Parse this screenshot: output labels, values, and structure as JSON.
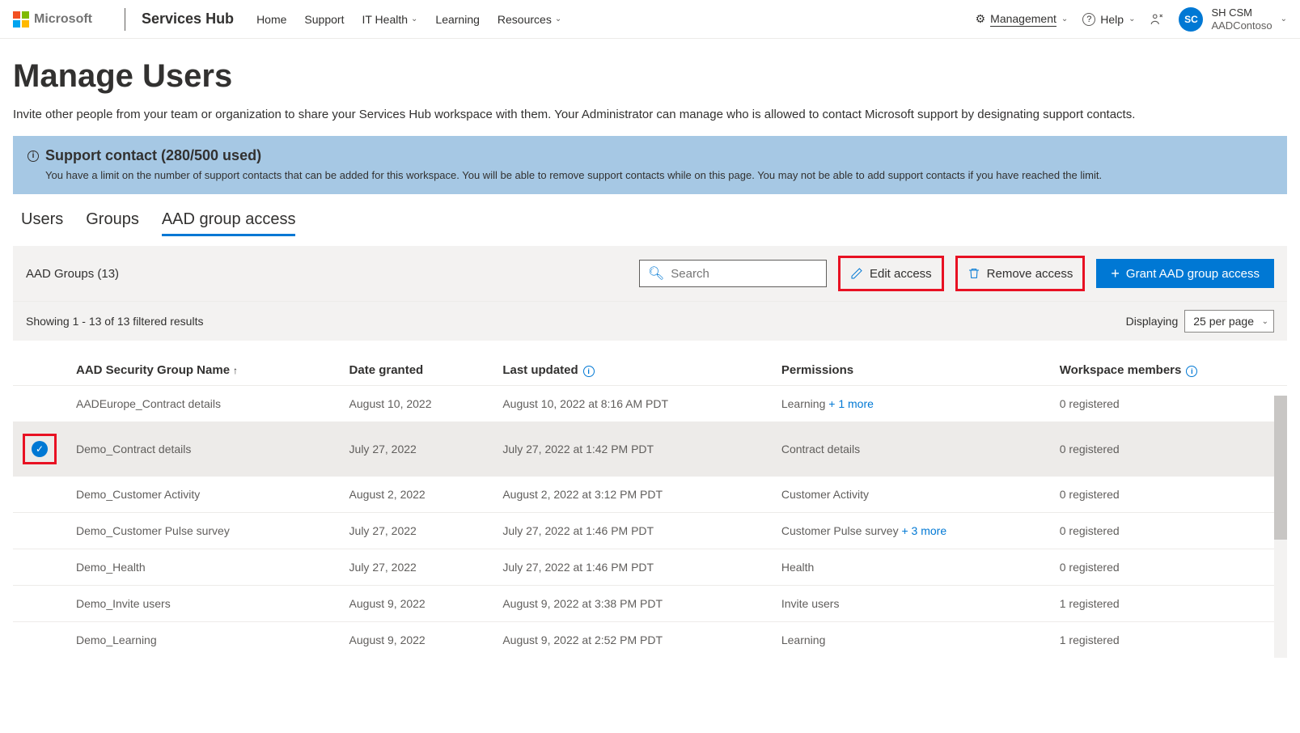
{
  "header": {
    "ms": "Microsoft",
    "app": "Services Hub",
    "nav": [
      "Home",
      "Support",
      "IT Health",
      "Learning",
      "Resources"
    ],
    "management": "Management",
    "help": "Help",
    "avatar_initials": "SC",
    "user_name": "SH CSM",
    "user_org": "AADContoso"
  },
  "page": {
    "title": "Manage Users",
    "subtitle": "Invite other people from your team or organization to share your Services Hub workspace with them. Your Administrator can manage who is allowed to contact Microsoft support by designating support contacts."
  },
  "banner": {
    "title": "Support contact (280/500 used)",
    "body": "You have a limit on the number of support contacts that can be added for this workspace. You will be able to remove support contacts while on this page. You may not be able to add support contacts if you have reached the limit."
  },
  "tabs": [
    "Users",
    "Groups",
    "AAD group access"
  ],
  "toolbar": {
    "title": "AAD Groups (13)",
    "search_placeholder": "Search",
    "edit": "Edit access",
    "remove": "Remove access",
    "grant": "Grant AAD group access"
  },
  "filter": {
    "showing": "Showing 1 - 13 of 13 filtered results",
    "displaying": "Displaying",
    "per_page": "25 per page"
  },
  "columns": {
    "name": "AAD Security Group Name",
    "date": "Date granted",
    "updated": "Last updated",
    "perms": "Permissions",
    "members": "Workspace members"
  },
  "rows": [
    {
      "name": "AADEurope_Contract details",
      "date": "August 10, 2022",
      "updated": "August 10, 2022 at 8:16 AM PDT",
      "perm": "Learning",
      "more": "+ 1 more",
      "members": "0 registered",
      "selected": false
    },
    {
      "name": "Demo_Contract details",
      "date": "July 27, 2022",
      "updated": "July 27, 2022 at 1:42 PM PDT",
      "perm": "Contract details",
      "more": "",
      "members": "0 registered",
      "selected": true
    },
    {
      "name": "Demo_Customer Activity",
      "date": "August 2, 2022",
      "updated": "August 2, 2022 at 3:12 PM PDT",
      "perm": "Customer Activity",
      "more": "",
      "members": "0 registered",
      "selected": false
    },
    {
      "name": "Demo_Customer Pulse survey",
      "date": "July 27, 2022",
      "updated": "July 27, 2022 at 1:46 PM PDT",
      "perm": "Customer Pulse survey",
      "more": "+ 3 more",
      "members": "0 registered",
      "selected": false
    },
    {
      "name": "Demo_Health",
      "date": "July 27, 2022",
      "updated": "July 27, 2022 at 1:46 PM PDT",
      "perm": "Health",
      "more": "",
      "members": "0 registered",
      "selected": false
    },
    {
      "name": "Demo_Invite users",
      "date": "August 9, 2022",
      "updated": "August 9, 2022 at 3:38 PM PDT",
      "perm": "Invite users",
      "more": "",
      "members": "1 registered",
      "selected": false
    },
    {
      "name": "Demo_Learning",
      "date": "August 9, 2022",
      "updated": "August 9, 2022 at 2:52 PM PDT",
      "perm": "Learning",
      "more": "",
      "members": "1 registered",
      "selected": false
    }
  ]
}
